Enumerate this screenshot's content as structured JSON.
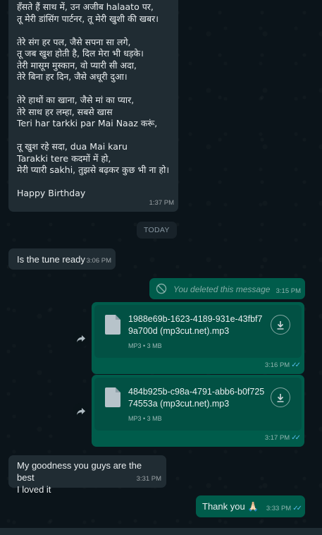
{
  "messages": {
    "lyrics": {
      "text": "हँसते हैं साथ में, उन अजीब halaato पर,\nतू मेरी डांसिंग पार्टनर, तू मेरी खुशी की खबर।\n\nतेरे संग हर पल, जैसे सपना सा लगे,\nतू जब खुश होती है, दिल मेरा भी धड़के।\nतेरी मासूम मुस्कान, वो प्यारी सी अदा,\nतेरे बिना हर दिन, जैसे अधूरी दुआ।\n\nतेरे हाथों का खाना, जैसे मां का प्यार,\nतेरे साथ हर लम्हा, सबसे खास\nTeri har tarkki par Mai Naaz करूं,\n\nतू खुश रहे सदा, dua Mai karu\nTarakki tere  कदमों में हो,\nमेरी प्यारी sakhi, तुझसे बढ़कर कुछ भी ना हो।\n\nHappy  Birthday",
      "time": "1:37 PM"
    },
    "date_divider": "TODAY",
    "tune_question": {
      "text": "Is the tune ready",
      "time": "3:06 PM"
    },
    "deleted": {
      "text": "You deleted this message",
      "time": "3:15 PM"
    },
    "file1": {
      "name": "1988e69b-1623-4189-931e-43fbf79a700d (mp3cut.net).mp3",
      "meta": "MP3 • 3 MB",
      "time": "3:16 PM"
    },
    "file2": {
      "name": "484b925b-c98a-4791-abb6-b0f72574553a (mp3cut.net).mp3",
      "meta": "MP3 • 3 MB",
      "time": "3:17 PM"
    },
    "goodness": {
      "text": "My goodness  you guys are the best\nI loved it",
      "time": "3:31 PM"
    },
    "thanks": {
      "text": "Thank you 🙏🏻",
      "time": "3:33 PM"
    }
  },
  "icons": {
    "document": "document-icon",
    "download": "download-icon",
    "forward": "forward-icon",
    "deleted": "blocked-icon",
    "read_receipt": "double-check-icon"
  },
  "colors": {
    "background": "#0b141a",
    "incoming": "#202c33",
    "outgoing": "#005c4b",
    "read_ticks": "#53bdeb"
  }
}
